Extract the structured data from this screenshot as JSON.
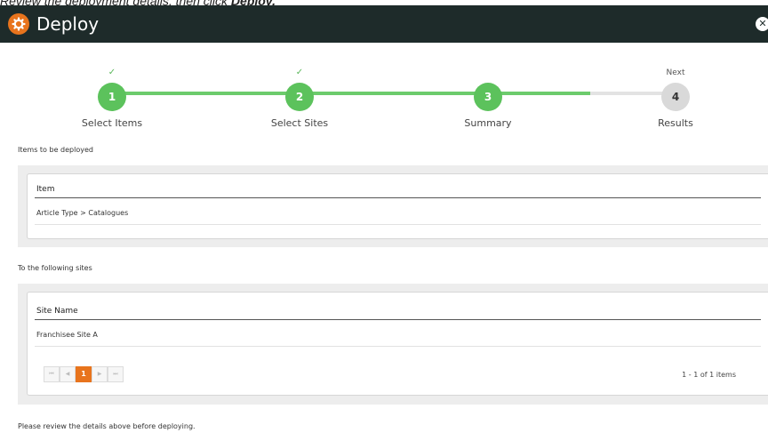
{
  "instruction": {
    "prefix": "Review the deployment details, then click ",
    "emphasis": "Deploy."
  },
  "header": {
    "title": "Deploy",
    "icon": "gear-icon",
    "close_icon": "close-icon",
    "background": "#1e2b2a",
    "accent": "#e8741d"
  },
  "wizard": {
    "steps": [
      {
        "number": "1",
        "label": "Select Items",
        "marker": "✓",
        "status": "complete"
      },
      {
        "number": "2",
        "label": "Select Sites",
        "marker": "✓",
        "status": "complete"
      },
      {
        "number": "3",
        "label": "Summary",
        "marker": "",
        "status": "current"
      },
      {
        "number": "4",
        "label": "Results",
        "marker": "Next",
        "status": "upcoming"
      }
    ],
    "progress_color": "#6ccb6c"
  },
  "items_section": {
    "label": "Items to be deployed",
    "column_header": "Item",
    "rows": [
      "Article Type > Catalogues"
    ]
  },
  "sites_section": {
    "label": "To the following sites",
    "column_header": "Site Name",
    "rows": [
      "Franchisee Site A"
    ],
    "pager": {
      "first": "⏮",
      "prev": "◀",
      "current_page": "1",
      "next": "▶",
      "last": "⏭",
      "info": "1 - 1 of 1 items"
    }
  },
  "footer_note": "Please review the details above before deploying."
}
